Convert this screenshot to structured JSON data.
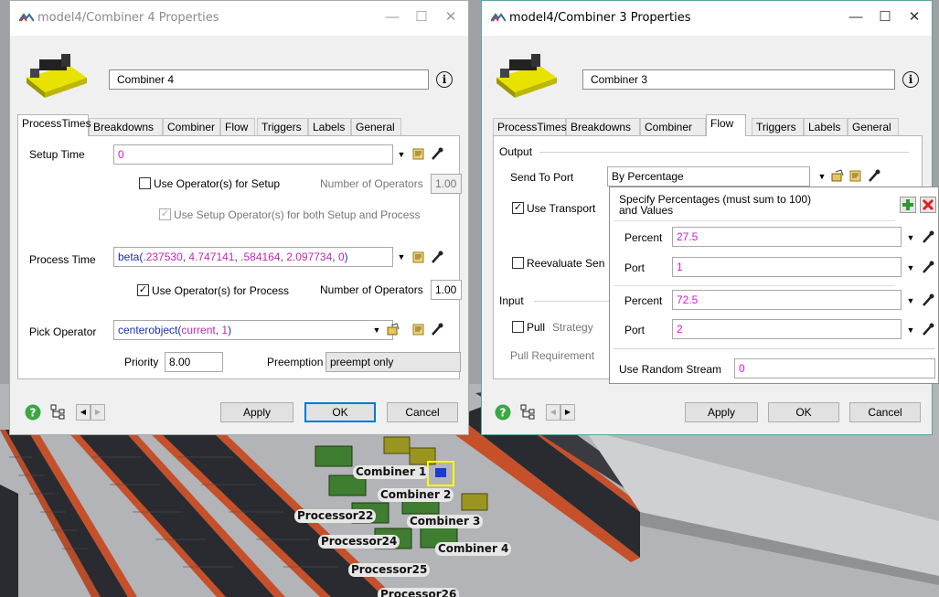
{
  "window1": {
    "title": "model4/Combiner 4  Properties",
    "name_value": "Combiner 4",
    "tabs": [
      "ProcessTimes",
      "Breakdowns",
      "Combiner",
      "Flow",
      "Triggers",
      "Labels",
      "General"
    ],
    "setup_time_label": "Setup Time",
    "setup_time_value": "0",
    "use_operator_setup": "Use Operator(s) for Setup",
    "num_operators_label": "Number of Operators",
    "num_operators_setup_value": "1.00",
    "use_setup_operator_both": "Use Setup Operator(s) for both Setup and Process",
    "process_time_label": "Process Time",
    "process_time_fn": "beta(",
    "process_time_args": [
      ".237530",
      "4.747141",
      ".584164",
      "2.097734",
      "0"
    ],
    "process_time_sep": ", ",
    "process_time_close": ")",
    "use_operator_process": "Use Operator(s) for Process",
    "num_operators_process_label": "Number of Operators",
    "num_operators_process_value": "1.00",
    "pick_operator_label": "Pick Operator",
    "pick_operator_fn": "centerobject(",
    "pick_operator_arg1": "current",
    "pick_operator_sep": ", ",
    "pick_operator_arg2": "1",
    "pick_operator_close": ")",
    "priority_label": "Priority",
    "priority_value": "8.00",
    "preemption_label": "Preemption",
    "preemption_value": "preempt only",
    "apply": "Apply",
    "ok": "OK",
    "cancel": "Cancel"
  },
  "window2": {
    "title": "model4/Combiner 3  Properties",
    "name_value": "Combiner 3",
    "tabs": [
      "ProcessTimes",
      "Breakdowns",
      "Combiner",
      "Flow",
      "Triggers",
      "Labels",
      "General"
    ],
    "output_group": "Output",
    "send_to_port_label": "Send To Port",
    "send_to_port_value": "By Percentage",
    "use_transport": "Use Transport",
    "reevaluate": "Reevaluate Sen",
    "input_group": "Input",
    "pull_label": "Pull",
    "strategy_label": "Strategy",
    "pull_requirement": "Pull Requirement",
    "apply": "Apply",
    "ok": "OK",
    "cancel": "Cancel"
  },
  "popup": {
    "header_line1": "Specify Percentages (must sum to 100)",
    "header_line2": "and Values",
    "rows": [
      {
        "label": "Percent",
        "value": "27.5"
      },
      {
        "label": "Port",
        "value": "1"
      },
      {
        "label": "Percent",
        "value": "72.5"
      },
      {
        "label": "Port",
        "value": "2"
      }
    ],
    "random_stream_label": "Use Random Stream",
    "random_stream_value": "0"
  },
  "scene_labels": [
    "Combiner 1",
    "Combiner 2",
    "Processor22",
    "Combiner 3",
    "Processor24",
    "Combiner 4",
    "Processor25",
    "Processor26"
  ],
  "colors": {
    "active_border": "#5aa5a0",
    "magenta_value": "#d11bd1",
    "function_blue": "#1a2eb0",
    "default_button": "#0078d7"
  }
}
